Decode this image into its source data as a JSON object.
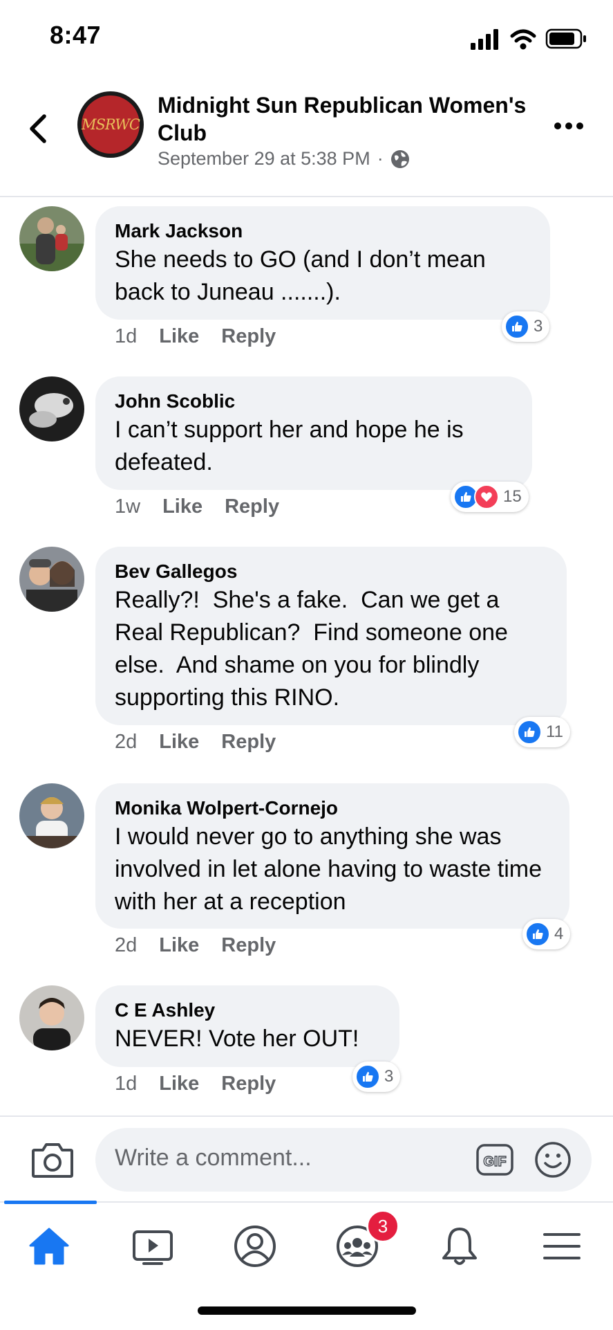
{
  "status_bar": {
    "time": "8:47"
  },
  "header": {
    "page_name": "Midnight Sun Republican Women's Club",
    "avatar_text": "MSRWC",
    "post_time": "September 29 at 5:38 PM",
    "separator": "·"
  },
  "comments": [
    {
      "name": "Mark Jackson",
      "text": "She needs to GO (and I don’t mean back to Juneau .......).",
      "age": "1d",
      "like": "Like",
      "reply": "Reply",
      "reactions": [
        "like"
      ],
      "reaction_count": "3"
    },
    {
      "name": "John Scoblic",
      "text": "I can’t support her and hope he is defeated.",
      "age": "1w",
      "like": "Like",
      "reply": "Reply",
      "reactions": [
        "like",
        "love"
      ],
      "reaction_count": "15"
    },
    {
      "name": "Bev Gallegos",
      "text": "Really?!  She's a fake.  Can we get a Real Republican?  Find someone one else.  And shame on you for blindly supporting this RINO.",
      "age": "2d",
      "like": "Like",
      "reply": "Reply",
      "reactions": [
        "like"
      ],
      "reaction_count": "11"
    },
    {
      "name": "Monika Wolpert-Cornejo",
      "text": "I would never go to anything she was involved in let alone having to waste time with her at a reception",
      "age": "2d",
      "like": "Like",
      "reply": "Reply",
      "reactions": [
        "like"
      ],
      "reaction_count": "4"
    },
    {
      "name": "C E Ashley",
      "text": "NEVER! Vote her OUT!",
      "age": "1d",
      "like": "Like",
      "reply": "Reply",
      "reactions": [
        "like"
      ],
      "reaction_count": "3"
    }
  ],
  "composer": {
    "placeholder": "Write a comment...",
    "gif_label": "GIF"
  },
  "tab_bar": {
    "tabs": [
      "home-icon",
      "video-icon",
      "profile-icon",
      "groups-icon",
      "bell-icon",
      "menu-icon"
    ],
    "active": "home-icon",
    "groups_badge": "3"
  },
  "colors": {
    "accent": "#1877f2",
    "love": "#f33e58",
    "badge": "#e41e3f",
    "bubble": "#f0f2f5",
    "secondary_text": "#65676b"
  }
}
